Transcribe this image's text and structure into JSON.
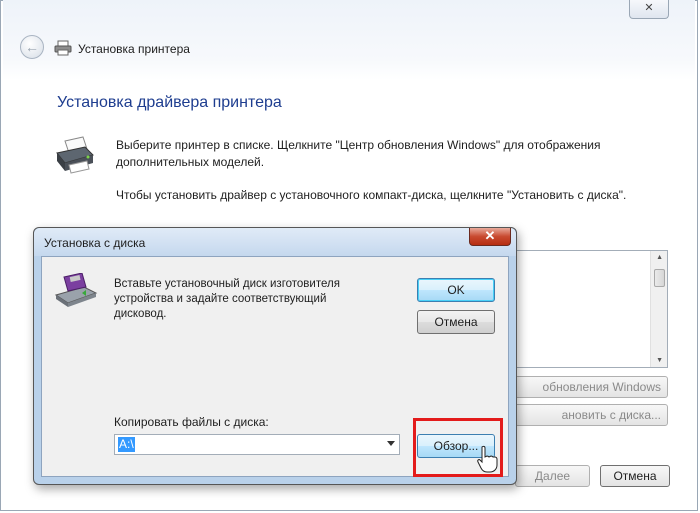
{
  "wizard": {
    "title": "Установка принтера",
    "heading": "Установка драйвера принтера",
    "description_1": "Выберите принтер в списке. Щелкните \"Центр обновления Windows\" для отображения дополнительных моделей.",
    "description_2": "Чтобы установить драйвер с установочного компакт-диска, щелкните \"Установить с диска\".",
    "windows_update_button": "обновления Windows",
    "have_disk_button": "ановить с диска...",
    "back_button": "Далее",
    "cancel_button": "Отмена"
  },
  "dialog": {
    "title": "Установка с диска",
    "message": "Вставьте установочный диск изготовителя устройства и задайте соответствующий дисковод.",
    "ok_button": "OK",
    "cancel_button": "Отмена",
    "copy_label": "Копировать файлы с диска:",
    "copy_value": "A:\\",
    "browse_button": "Обзор..."
  },
  "highlight_color": "#e31b1b",
  "accent_color": "#1e3d8f"
}
